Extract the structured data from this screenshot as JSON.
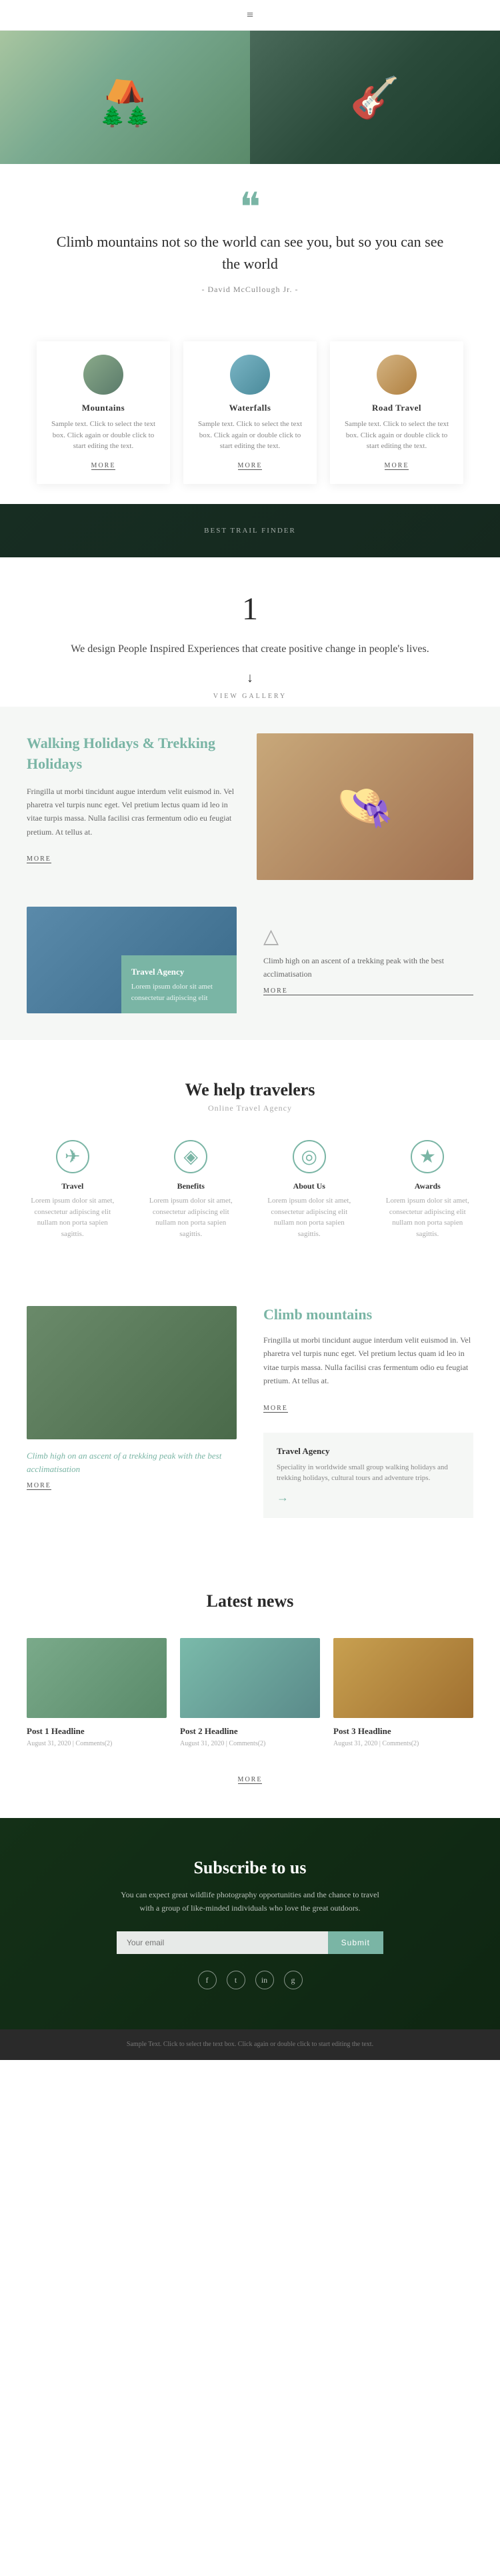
{
  "header": {
    "menu_icon": "≡"
  },
  "hero": {
    "left_alt": "Camping tent in forest",
    "right_alt": "Person with guitar"
  },
  "quote": {
    "mark": "❝",
    "text": "Climb mountains not so the world can see you, but so you can see the world",
    "author": "- David McCullough Jr. -"
  },
  "cards": [
    {
      "title": "Mountains",
      "text": "Sample text. Click to select the text box. Click again or double click to start editing the text.",
      "more": "MORE"
    },
    {
      "title": "Waterfalls",
      "text": "Sample text. Click to select the text box. Click again or double click to start editing the text.",
      "more": "MORE"
    },
    {
      "title": "Road Travel",
      "text": "Sample text. Click to select the text box. Click again or double click to start editing the text.",
      "more": "MORE"
    }
  ],
  "banner": {
    "text": "BEST TRAIL FINDER"
  },
  "number_section": {
    "number": "1",
    "tagline": "We design People Inspired Experiences that create positive change in people's lives.",
    "arrow": "↓",
    "view_gallery": "VIEW GALLERY"
  },
  "trekking": {
    "title": "Walking Holidays & Trekking Holidays",
    "text": "Fringilla ut morbi tincidunt augue interdum velit euismod in. Vel pharetra vel turpis nunc eget. Vel pretium lectus quam id leo in vitae turpis massa. Nulla facilisi cras fermentum odio eu feugiat pretium. At tellus at.",
    "more": "MORE",
    "sub_overlay_title": "Travel Agency",
    "sub_overlay_text": "Lorem ipsum dolor sit amet consectetur adipiscing elit",
    "sub_right_text": "Climb high on an ascent of a trekking peak with the best acclimatisation",
    "sub_right_more": "MORE"
  },
  "help": {
    "title": "We help travelers",
    "subtitle": "Online Travel Agency",
    "items": [
      {
        "icon": "✈",
        "label": "Travel",
        "text": "Lorem ipsum dolor sit amet, consectetur adipiscing elit nullam non porta sapien sagittis."
      },
      {
        "icon": "♦",
        "label": "Benefits",
        "text": "Lorem ipsum dolor sit amet, consectetur adipiscing elit nullam non porta sapien sagittis."
      },
      {
        "icon": "◎",
        "label": "About Us",
        "text": "Lorem ipsum dolor sit amet, consectetur adipiscing elit nullam non porta sapien sagittis."
      },
      {
        "icon": "★",
        "label": "Awards",
        "text": "Lorem ipsum dolor sit amet, consectetur adipiscing elit nullam non porta sapien sagittis."
      }
    ]
  },
  "climb": {
    "caption": "Climb high on an ascent of a trekking peak with the best acclimatisation",
    "more_left": "MORE",
    "title": "Climb mountains",
    "text": "Fringilla ut morbi tincidunt augue interdum velit euismod in. Vel pharetra vel turpis nunc eget. Vel pretium lectus quam id leo in vitae turpis massa. Nulla facilisi cras fermentum odio eu feugiat pretium. At tellus at.",
    "more_right": "MORE",
    "agency_title": "Travel Agency",
    "agency_text": "Speciality in worldwide small group walking holidays and trekking holidays, cultural tours and adventure trips.",
    "agency_arrow": "→"
  },
  "news": {
    "title": "Latest news",
    "posts": [
      {
        "headline": "Post 1 Headline",
        "meta": "August 31, 2020 | Comments(2)"
      },
      {
        "headline": "Post 2 Headline",
        "meta": "August 31, 2020 | Comments(2)"
      },
      {
        "headline": "Post 3 Headline",
        "meta": "August 31, 2020 | Comments(2)"
      }
    ],
    "more": "MORE"
  },
  "subscribe": {
    "title": "Subscribe to us",
    "text": "You can expect great wildlife photography opportunities and the chance to travel with a group of like-minded individuals who love the great outdoors.",
    "input_placeholder": "Your email",
    "button_label": "Submit",
    "social": [
      "f",
      "t",
      "in",
      "g"
    ]
  },
  "footer": {
    "text": "Sample Text. Click to select the text box. Click again or double click to start editing the text."
  }
}
